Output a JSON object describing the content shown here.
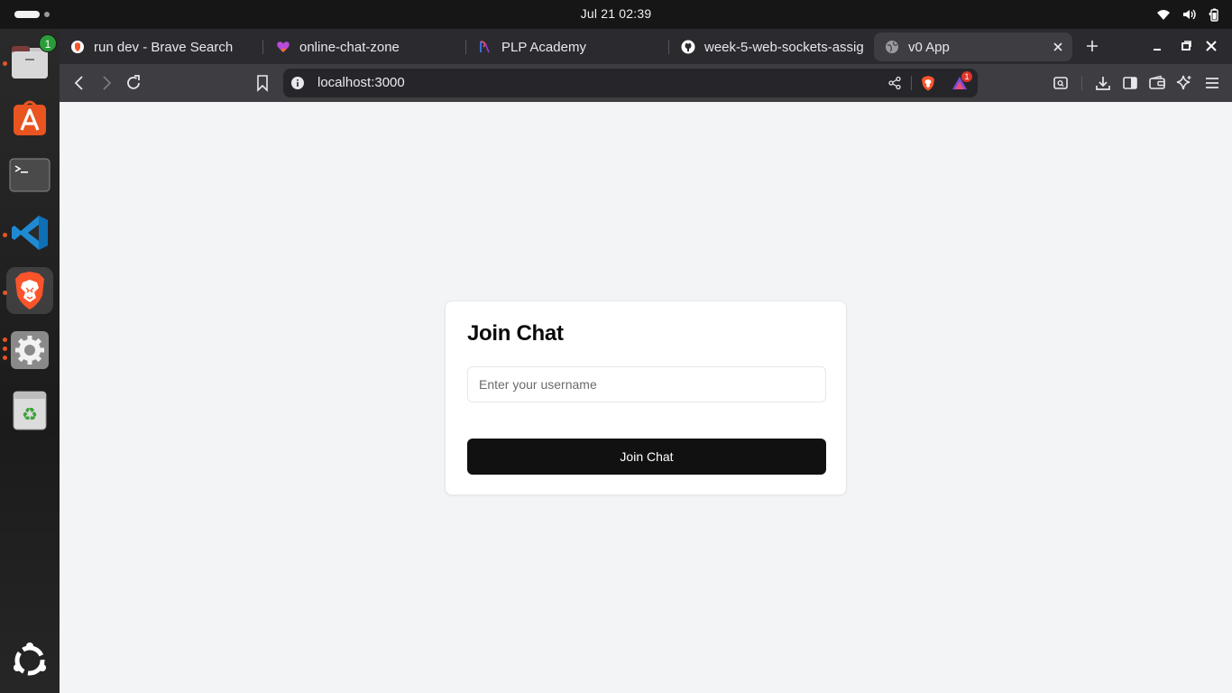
{
  "system_bar": {
    "clock": "Jul 21  02:39"
  },
  "dock": {
    "items": [
      {
        "name": "files",
        "badge": "1"
      },
      {
        "name": "app-center"
      },
      {
        "name": "terminal"
      },
      {
        "name": "vscode"
      },
      {
        "name": "brave-browser"
      },
      {
        "name": "settings"
      },
      {
        "name": "trash"
      },
      {
        "name": "show-apps"
      }
    ]
  },
  "browser": {
    "tabs": [
      {
        "title": "run dev - Brave Search",
        "icon": "brave-search-icon"
      },
      {
        "title": "online-chat-zone",
        "icon": "heart-app-icon"
      },
      {
        "title": "PLP Academy",
        "icon": "plp-icon"
      },
      {
        "title": "week-5-web-sockets-assig",
        "icon": "github-icon"
      },
      {
        "title": "v0 App",
        "icon": "globe-icon",
        "active": true
      }
    ],
    "url": "localhost:3000",
    "shields_badge": "1"
  },
  "card": {
    "title": "Join Chat",
    "username_placeholder": "Enter your username",
    "button_label": "Join Chat"
  },
  "colors": {
    "page_bg": "#f3f4f6",
    "card_bg": "#ffffff",
    "button_bg": "#111111",
    "brave_orange": "#fb542b",
    "ubuntu_orange": "#e95420"
  }
}
